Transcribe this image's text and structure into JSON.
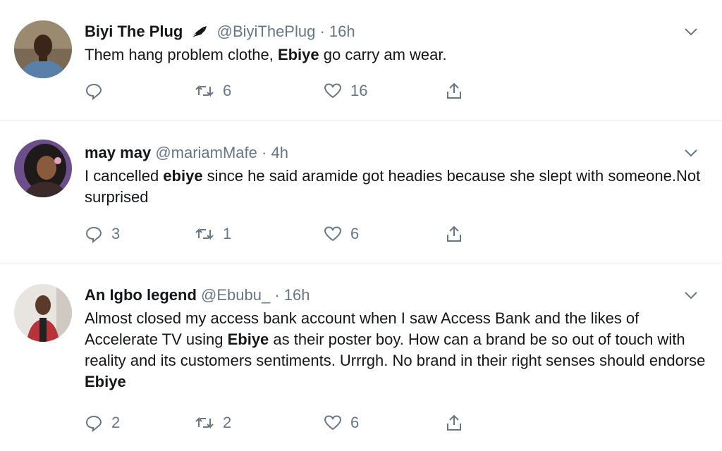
{
  "tweets": [
    {
      "name": "Biyi The Plug",
      "badge": "pen-nib-icon",
      "handle": "@BiyiThePlug",
      "separator": "·",
      "time": "16h",
      "text_parts": [
        "Them hang problem clothe, ",
        "Ebiye",
        " go carry am wear."
      ],
      "replies": "",
      "retweets": "6",
      "likes": "16"
    },
    {
      "name": "may may",
      "handle": "@mariamMafe",
      "separator": "·",
      "time": "4h",
      "text_parts": [
        "I cancelled ",
        "ebiye",
        " since he said aramide got headies because she slept with someone.Not surprised"
      ],
      "replies": "3",
      "retweets": "1",
      "likes": "6"
    },
    {
      "name": "An Igbo legend",
      "handle": "@Ebubu_",
      "separator": "·",
      "time": "16h",
      "text_parts": [
        "Almost closed my access bank account when I saw Access Bank and the likes of Accelerate TV using ",
        "Ebiye",
        " as their poster boy. How can a brand be so out of touch with reality and its customers sentiments. Urrrgh. No brand in their right senses should endorse ",
        "Ebiye"
      ],
      "replies": "2",
      "retweets": "2",
      "likes": "6"
    }
  ],
  "colors": {
    "text": "#14171a",
    "secondary": "#657786",
    "divider": "#e6ecf0"
  }
}
